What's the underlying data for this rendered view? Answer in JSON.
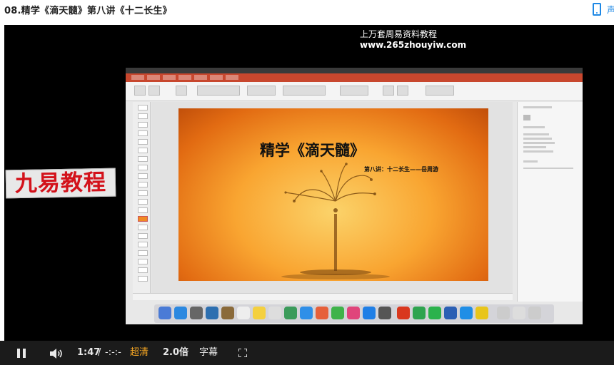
{
  "page": {
    "title": "08.精学《滴天髓》第八讲《十二长生》",
    "side_tab_label": "声"
  },
  "watermark": {
    "line1": "上万套周易资料教程",
    "line2": "www.265zhouyiw.com"
  },
  "logo_text": "九易教程",
  "slide": {
    "title": "精学《滴天髓》",
    "subtitle": "第八讲：十二长生——岳周游"
  },
  "controls": {
    "current_time": "1:47",
    "separator": "/",
    "duration": "-:-:-",
    "quality": "超清",
    "speed": "2.0倍",
    "subtitle": "字幕"
  },
  "colors": {
    "accent": "#1e88e5",
    "quality_active": "#f5a623",
    "control_bar": "#1b1b1b",
    "logo_red": "#d3121b"
  },
  "icons": [
    "pause-icon",
    "volume-icon",
    "fullscreen-icon",
    "phone-icon"
  ]
}
